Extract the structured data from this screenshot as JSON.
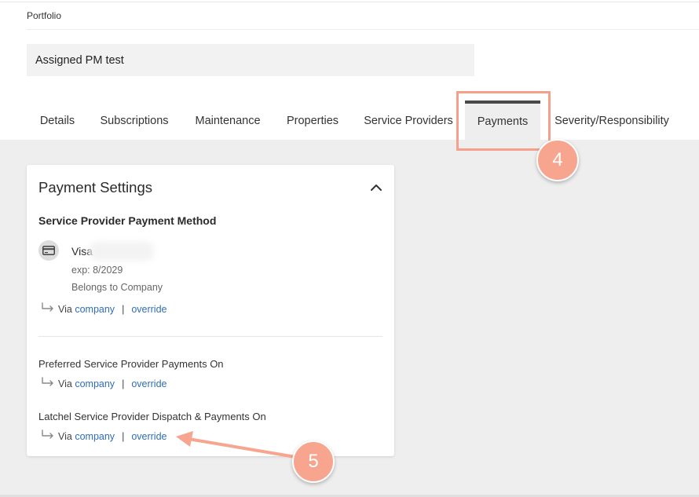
{
  "header": {
    "breadcrumb": "Portfolio",
    "name_value": "Assigned PM test"
  },
  "tabs": [
    {
      "label": "Details",
      "active": false
    },
    {
      "label": "Subscriptions",
      "active": false
    },
    {
      "label": "Maintenance",
      "active": false
    },
    {
      "label": "Properties",
      "active": false
    },
    {
      "label": "Service Providers",
      "active": false
    },
    {
      "label": "Payments",
      "active": true
    },
    {
      "label": "Severity/Responsibility",
      "active": false
    }
  ],
  "payment_settings": {
    "title": "Payment Settings",
    "collapse_icon": "chevron-up-icon",
    "method_heading": "Service Provider Payment Method",
    "payment_method": {
      "icon": "credit-card-icon",
      "brand": "Visa",
      "expiration": "exp: 8/2029",
      "owner": "Belongs to Company"
    },
    "via_prefix": "Via",
    "company_link": "company",
    "separator": "|",
    "override_link": "override",
    "settings": [
      {
        "label": "Preferred Service Provider Payments On"
      },
      {
        "label": "Latchel Service Provider Dispatch & Payments On"
      }
    ]
  },
  "annotations": {
    "step_tab": "4",
    "step_override": "5",
    "color": "#f7a58f"
  }
}
